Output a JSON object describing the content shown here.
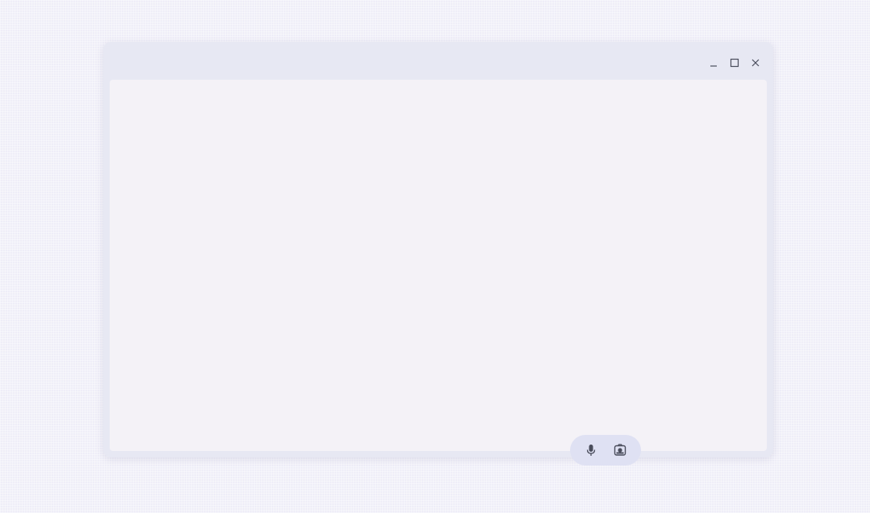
{
  "window": {
    "title": "",
    "controls": {
      "minimize_icon": "minimize-icon",
      "maximize_icon": "maximize-icon",
      "close_icon": "close-icon"
    }
  },
  "toolbar": {
    "buttons": [
      {
        "icon": "microphone-icon"
      },
      {
        "icon": "screenshot-icon"
      }
    ]
  },
  "colors": {
    "desktop_background": "#efeef8",
    "window_frame": "#e7e8f3",
    "window_content": "#f4f2f7",
    "toolbar_pill": "#dfe1f3",
    "icon": "#4a4d5c"
  }
}
